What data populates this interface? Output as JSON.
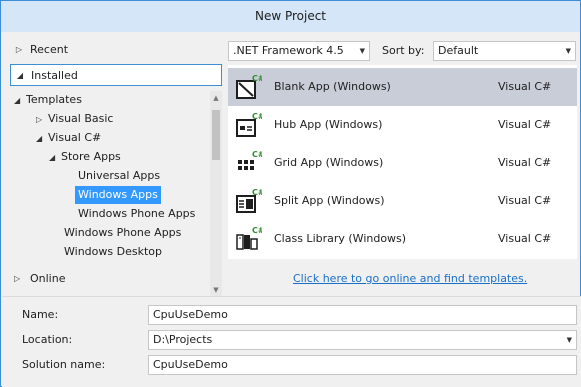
{
  "window": {
    "title": "New Project"
  },
  "nav": {
    "recent": "Recent",
    "installed": "Installed",
    "online": "Online"
  },
  "tree": {
    "templates": "Templates",
    "visual_basic": "Visual Basic",
    "visual_csharp": "Visual C#",
    "store_apps": "Store Apps",
    "universal_apps": "Universal Apps",
    "windows_apps": "Windows Apps",
    "windows_phone_apps_sub": "Windows Phone Apps",
    "windows_phone_apps": "Windows Phone Apps",
    "windows_desktop": "Windows Desktop"
  },
  "toolbar": {
    "framework": ".NET Framework 4.5",
    "sort_label": "Sort by:",
    "sort_value": "Default"
  },
  "templates": [
    {
      "name": "Blank App (Windows)",
      "language": "Visual C#",
      "icon": "blank-app-icon"
    },
    {
      "name": "Hub App (Windows)",
      "language": "Visual C#",
      "icon": "hub-app-icon"
    },
    {
      "name": "Grid App (Windows)",
      "language": "Visual C#",
      "icon": "grid-app-icon"
    },
    {
      "name": "Split App (Windows)",
      "language": "Visual C#",
      "icon": "split-app-icon"
    },
    {
      "name": "Class Library (Windows)",
      "language": "Visual C#",
      "icon": "class-library-icon"
    }
  ],
  "online_link": "Click here to go online and find templates.",
  "form": {
    "name_label": "Name:",
    "name_value": "CpuUseDemo",
    "location_label": "Location:",
    "location_value": "D:\\Projects",
    "solution_label": "Solution name:",
    "solution_value": "CpuUseDemo"
  },
  "colors": {
    "accent": "#3c8fd6",
    "selection": "#3399ff",
    "csharp_green": "#2f8a2f",
    "link": "#1a6fc9"
  }
}
